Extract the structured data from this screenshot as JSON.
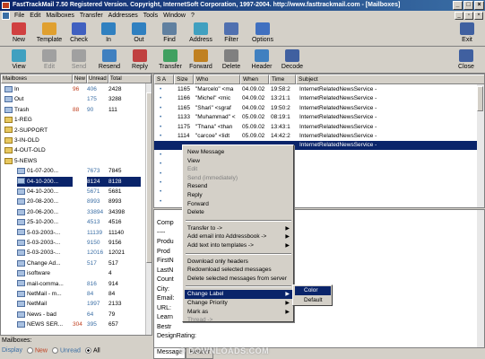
{
  "window": {
    "title": "FastTrackMail 7.50  Registered Version. Copyright, InternetSoft Corporation, 1997-2004. http://www.fasttrackmail.com - [Mailboxes]"
  },
  "menu": [
    "File",
    "Edit",
    "Mailboxes",
    "Transfer",
    "Addresses",
    "Tools",
    "Window",
    "?"
  ],
  "toolbar1": [
    {
      "label": "New",
      "icon": "new-mail-icon",
      "color": "#d04040"
    },
    {
      "label": "Template",
      "icon": "template-icon",
      "color": "#e0a030"
    },
    {
      "label": "Check",
      "icon": "check-mail-icon",
      "color": "#4060c0"
    },
    {
      "label": "In",
      "icon": "inbox-icon",
      "color": "#3080c0"
    },
    {
      "label": "Out",
      "icon": "outbox-icon",
      "color": "#3080c0"
    },
    {
      "label": "Find",
      "icon": "find-icon",
      "color": "#6080a0"
    },
    {
      "label": "Address",
      "icon": "address-icon",
      "color": "#40a0c0"
    },
    {
      "label": "Filter",
      "icon": "filter-icon",
      "color": "#5070b0"
    },
    {
      "label": "Options",
      "icon": "options-icon",
      "color": "#4070c0"
    },
    {
      "label": "Exit",
      "icon": "exit-icon",
      "color": "#4060a0"
    }
  ],
  "toolbar2": [
    {
      "label": "View",
      "icon": "view-icon",
      "color": "#40a0c0",
      "disabled": false
    },
    {
      "label": "Edit",
      "icon": "edit-icon",
      "color": "#a0a0a0",
      "disabled": true
    },
    {
      "label": "Send",
      "icon": "send-icon",
      "color": "#a0a0a0",
      "disabled": true
    },
    {
      "label": "Resend",
      "icon": "resend-icon",
      "color": "#4080c0",
      "disabled": false
    },
    {
      "label": "Reply",
      "icon": "reply-icon",
      "color": "#c04040",
      "disabled": false
    },
    {
      "label": "Transfer",
      "icon": "transfer-icon",
      "color": "#40a060",
      "disabled": false
    },
    {
      "label": "Forward",
      "icon": "forward-icon",
      "color": "#c08020",
      "disabled": false
    },
    {
      "label": "Delete",
      "icon": "delete-icon",
      "color": "#808080",
      "disabled": false
    },
    {
      "label": "Header",
      "icon": "header-icon",
      "color": "#4080c0",
      "disabled": false
    },
    {
      "label": "Decode",
      "icon": "decode-icon",
      "color": "#4060a0",
      "disabled": false
    },
    {
      "label": "Close",
      "icon": "close-icon",
      "color": "#4060a0",
      "disabled": false
    }
  ],
  "tree": {
    "headers": [
      "Mailboxes",
      "New",
      "Unread",
      "Total"
    ],
    "rows": [
      {
        "name": "In",
        "new": "96",
        "unread": "406",
        "total": "2428",
        "indent": 0,
        "folder": false
      },
      {
        "name": "Out",
        "new": "",
        "unread": "175",
        "total": "3288",
        "indent": 0,
        "folder": false
      },
      {
        "name": "Trash",
        "new": "88",
        "unread": "90",
        "total": "111",
        "indent": 0,
        "folder": false
      },
      {
        "name": "1-REG",
        "new": "",
        "unread": "",
        "total": "",
        "indent": 0,
        "folder": true
      },
      {
        "name": "2-SUPPORT",
        "new": "",
        "unread": "",
        "total": "",
        "indent": 0,
        "folder": true
      },
      {
        "name": "3-IN-OLD",
        "new": "",
        "unread": "",
        "total": "",
        "indent": 0,
        "folder": true
      },
      {
        "name": "4-OUT-OLD",
        "new": "",
        "unread": "",
        "total": "",
        "indent": 0,
        "folder": true
      },
      {
        "name": "5-NEWS",
        "new": "",
        "unread": "",
        "total": "",
        "indent": 0,
        "folder": true
      },
      {
        "name": "01-07-200...",
        "new": "",
        "unread": "7673",
        "total": "7845",
        "indent": 1,
        "folder": false
      },
      {
        "name": "04-10-200...",
        "new": "",
        "unread": "8124",
        "total": "8128",
        "indent": 1,
        "folder": false,
        "selected": true
      },
      {
        "name": "04-10-200...",
        "new": "",
        "unread": "5671",
        "total": "5681",
        "indent": 1,
        "folder": false
      },
      {
        "name": "20-08-200...",
        "new": "",
        "unread": "8993",
        "total": "8993",
        "indent": 1,
        "folder": false
      },
      {
        "name": "20-06-200...",
        "new": "",
        "unread": "33894",
        "total": "34398",
        "indent": 1,
        "folder": false
      },
      {
        "name": "25-10-200...",
        "new": "",
        "unread": "4513",
        "total": "4516",
        "indent": 1,
        "folder": false
      },
      {
        "name": "5-03-2003-...",
        "new": "",
        "unread": "11139",
        "total": "11140",
        "indent": 1,
        "folder": false
      },
      {
        "name": "5-03-2003-...",
        "new": "",
        "unread": "9150",
        "total": "9156",
        "indent": 1,
        "folder": false
      },
      {
        "name": "5-03-2003-...",
        "new": "",
        "unread": "12016",
        "total": "12021",
        "indent": 1,
        "folder": false
      },
      {
        "name": "Change Ad...",
        "new": "",
        "unread": "517",
        "total": "517",
        "indent": 1,
        "folder": false
      },
      {
        "name": "isoftware",
        "new": "",
        "unread": "",
        "total": "4",
        "indent": 1,
        "folder": false
      },
      {
        "name": "mail-comma...",
        "new": "",
        "unread": "816",
        "total": "914",
        "indent": 1,
        "folder": false
      },
      {
        "name": "NetMail - m...",
        "new": "",
        "unread": "84",
        "total": "84",
        "indent": 1,
        "folder": false
      },
      {
        "name": "NetMail",
        "new": "",
        "unread": "1997",
        "total": "2133",
        "indent": 1,
        "folder": false
      },
      {
        "name": "News - bad",
        "new": "",
        "unread": "64",
        "total": "79",
        "indent": 1,
        "folder": false
      },
      {
        "name": "NEWS SER...",
        "new": "304",
        "unread": "395",
        "total": "657",
        "indent": 1,
        "folder": false
      }
    ]
  },
  "bottom": {
    "title": "Mailboxes:",
    "display": "Display",
    "options": [
      {
        "label": "New",
        "color": "#c04020",
        "checked": false
      },
      {
        "label": "Unread",
        "color": "#3a6ea5",
        "checked": false
      },
      {
        "label": "All",
        "color": "#000000",
        "checked": true
      }
    ]
  },
  "list": {
    "headers": [
      "S A",
      "Size",
      "Who",
      "When",
      "Time",
      "Subject"
    ],
    "rows": [
      {
        "mark": "•",
        "size": "1165",
        "who": "\"Marcelo\" <ma",
        "when": "04.09.02",
        "time": "19:58:2",
        "subject": "InternetRelatedNewsService -"
      },
      {
        "mark": "•",
        "size": "1166",
        "who": "\"Michel\" <mic",
        "when": "04.09.02",
        "time": "13:21:1",
        "subject": "InternetRelatedNewsService -"
      },
      {
        "mark": "•",
        "size": "1165",
        "who": "\"Shari\" <sgraf",
        "when": "04.09.02",
        "time": "19:50:2",
        "subject": "InternetRelatedNewsService -"
      },
      {
        "mark": "•",
        "size": "1133",
        "who": "\"Muhammad\" <",
        "when": "05.09.02",
        "time": "08:19:1",
        "subject": "InternetRelatedNewsService -"
      },
      {
        "mark": "•",
        "size": "1175",
        "who": "\"Thana\" <than",
        "when": "05.09.02",
        "time": "13:43:1",
        "subject": "InternetRelatedNewsService -"
      },
      {
        "mark": "•",
        "size": "1114",
        "who": "\"carcoe\" <lidt",
        "when": "05.09.02",
        "time": "14:42:2",
        "subject": "InternetRelatedNewsService -"
      },
      {
        "mark": "",
        "size": "",
        "who": "",
        "when": "",
        "time": "",
        "subject": "InternetRelatedNewsService -",
        "selected": true
      },
      {
        "mark": "•",
        "size": "",
        "who": "",
        "when": "",
        "time": "",
        "subject": ""
      },
      {
        "mark": "•",
        "size": "",
        "who": "",
        "when": "",
        "time": "",
        "subject": ""
      },
      {
        "mark": "•",
        "size": "",
        "who": "",
        "when": "",
        "time": "",
        "subject": ""
      },
      {
        "mark": "•",
        "size": "",
        "who": "",
        "when": "",
        "time": "",
        "subject": ""
      },
      {
        "mark": "•",
        "size": "",
        "who": "",
        "when": "",
        "time": "",
        "subject": ""
      },
      {
        "mark": "•",
        "size": "",
        "who": "",
        "when": "",
        "time": "",
        "subject": ""
      }
    ]
  },
  "preview": {
    "lines": [
      "Comp",
      "----",
      "Produ",
      "Prod",
      "FirstN",
      "LastN",
      "Count",
      "City:",
      "Email:",
      "URL:",
      "Learn",
      "Bestr",
      "DesignRating:"
    ]
  },
  "tabs": [
    "Message",
    "Header"
  ],
  "context_menu": {
    "items": [
      {
        "label": "New Message",
        "disabled": false,
        "arrow": false
      },
      {
        "label": "View",
        "disabled": false,
        "arrow": false
      },
      {
        "label": "Edit",
        "disabled": true,
        "arrow": false
      },
      {
        "label": "Send (immediately)",
        "disabled": true,
        "arrow": false
      },
      {
        "label": "Resend",
        "disabled": false,
        "arrow": false
      },
      {
        "label": "Reply",
        "disabled": false,
        "arrow": false
      },
      {
        "label": "Forward",
        "disabled": false,
        "arrow": false
      },
      {
        "label": "Delete",
        "disabled": false,
        "arrow": false
      },
      {
        "sep": true
      },
      {
        "label": "Transfer to ->",
        "disabled": false,
        "arrow": true
      },
      {
        "label": "Add email into Addressbook ->",
        "disabled": false,
        "arrow": true
      },
      {
        "label": "Add text into templates ->",
        "disabled": false,
        "arrow": true
      },
      {
        "sep": true
      },
      {
        "label": "Download only headers",
        "disabled": false,
        "arrow": false
      },
      {
        "label": "Redownload selected messages",
        "disabled": false,
        "arrow": false
      },
      {
        "label": "Delete selected messages from server",
        "disabled": false,
        "arrow": false
      },
      {
        "sep": true
      },
      {
        "label": "Change Label",
        "disabled": false,
        "arrow": true,
        "highlight": true
      },
      {
        "label": "Change Priority",
        "disabled": false,
        "arrow": true
      },
      {
        "label": "Mark as",
        "disabled": false,
        "arrow": true
      },
      {
        "label": "Thread ->",
        "disabled": true,
        "arrow": false
      }
    ]
  },
  "submenu": {
    "items": [
      {
        "label": "Color",
        "highlight": true
      },
      {
        "label": "Default",
        "highlight": false
      }
    ]
  },
  "watermark": "© DOWNLOADS.COM"
}
